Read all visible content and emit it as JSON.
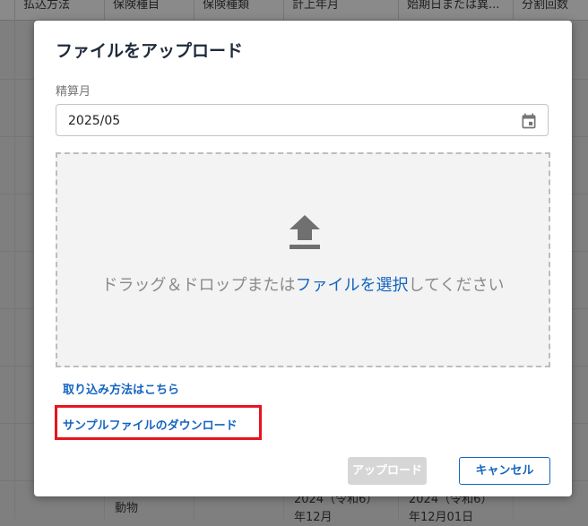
{
  "background_table": {
    "headers": [
      "払込方法",
      "保険種目",
      "保険種類",
      "計上年月",
      "始期日または異...",
      "分割回数"
    ],
    "visible_cells": {
      "insurance_type": "動物",
      "posting_month_line1": "2024（令和6）",
      "posting_month_line2": "年12月",
      "start_date_line1": "2024（令和6）",
      "start_date_line2": "年12月01日"
    }
  },
  "modal": {
    "title": "ファイルをアップロード",
    "settlement_month_label": "精算月",
    "settlement_month_value": "2025/05",
    "dropzone": {
      "text_before": "ドラッグ＆ドロップまたは",
      "link_text": "ファイルを選択",
      "text_after": "してください"
    },
    "howto_link": "取り込み方法はこちら",
    "sample_download_link": "サンプルファイルのダウンロード",
    "buttons": {
      "upload": "アップロード",
      "cancel": "キャンセル"
    }
  },
  "colors": {
    "accent": "#1565c0",
    "highlight": "#e8141e",
    "disabled_button": "#d6d6d6"
  },
  "icons": {
    "date_field": "calendar-icon",
    "dropzone": "upload-icon"
  }
}
